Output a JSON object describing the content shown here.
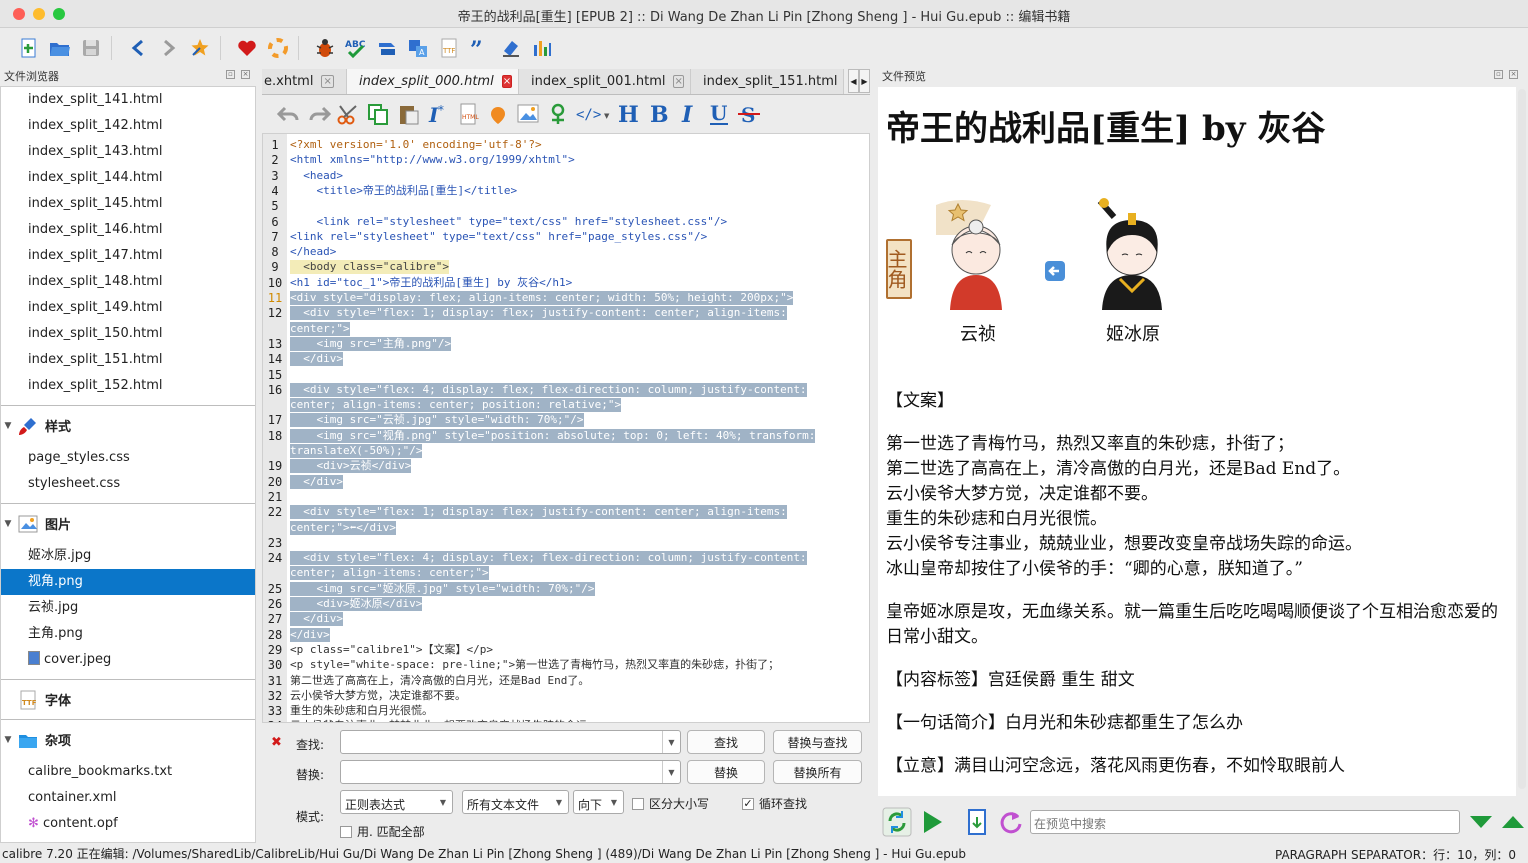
{
  "window": {
    "title": "帝王的战利品[重生] [EPUB 2] :: Di Wang De Zhan Li Pin [Zhong Sheng ] - Hui Gu.epub :: 编辑书籍"
  },
  "file_browser": {
    "title": "文件浏览器",
    "text_files": [
      "index_split_141.html",
      "index_split_142.html",
      "index_split_143.html",
      "index_split_144.html",
      "index_split_145.html",
      "index_split_146.html",
      "index_split_147.html",
      "index_split_148.html",
      "index_split_149.html",
      "index_split_150.html",
      "index_split_151.html",
      "index_split_152.html"
    ],
    "styles_label": "样式",
    "styles": [
      "page_styles.css",
      "stylesheet.css"
    ],
    "images_label": "图片",
    "images": [
      "姬冰原.jpg",
      "视角.png",
      "云祯.jpg",
      "主角.png",
      "cover.jpeg"
    ],
    "fonts_label": "字体",
    "misc_label": "杂项",
    "misc": [
      "calibre_bookmarks.txt",
      "container.xml",
      "content.opf"
    ]
  },
  "tabs": [
    {
      "label": "e.xhtml"
    },
    {
      "label": "index_split_000.html"
    },
    {
      "label": "index_split_001.html"
    },
    {
      "label": "index_split_151.html"
    }
  ],
  "editor": {
    "lines": [
      {
        "n": "1",
        "t": "<?xml version='1.0' encoding='utf-8'?>"
      },
      {
        "n": "2",
        "t": "<html xmlns=\"http://www.w3.org/1999/xhtml\">"
      },
      {
        "n": "3",
        "t": "  <head>"
      },
      {
        "n": "4",
        "t": "    <title>帝王的战利品[重生]</title>"
      },
      {
        "n": "5",
        "t": ""
      },
      {
        "n": "6",
        "t": "    <link rel=\"stylesheet\" type=\"text/css\" href=\"stylesheet.css\"/>"
      },
      {
        "n": "7",
        "t": "<link rel=\"stylesheet\" type=\"text/css\" href=\"page_styles.css\"/>"
      },
      {
        "n": "8",
        "t": "</head>"
      },
      {
        "n": "9",
        "t": "  <body class=\"calibre\">"
      },
      {
        "n": "10",
        "t": "<h1 id=\"toc_1\">帝王的战利品[重生] by 灰谷</h1>"
      },
      {
        "n": "11",
        "t": "<div style=\"display: flex; align-items: center; width: 50%; height: 200px;\">"
      },
      {
        "n": "12",
        "t": "  <div style=\"flex: 1; display: flex; justify-content: center; align-items:"
      },
      {
        "n": "",
        "t": "center;\">"
      },
      {
        "n": "13",
        "t": "    <img src=\"主角.png\"/>"
      },
      {
        "n": "14",
        "t": "  </div>"
      },
      {
        "n": "15",
        "t": ""
      },
      {
        "n": "16",
        "t": "  <div style=\"flex: 4; display: flex; flex-direction: column; justify-content:"
      },
      {
        "n": "",
        "t": "center; align-items: center; position: relative;\">"
      },
      {
        "n": "17",
        "t": "    <img src=\"云祯.jpg\" style=\"width: 70%;\"/>"
      },
      {
        "n": "18",
        "t": "    <img src=\"视角.png\" style=\"position: absolute; top: 0; left: 40%; transform:"
      },
      {
        "n": "",
        "t": "translateX(-50%);\"/>"
      },
      {
        "n": "19",
        "t": "    <div>云祯</div>"
      },
      {
        "n": "20",
        "t": "  </div>"
      },
      {
        "n": "21",
        "t": ""
      },
      {
        "n": "22",
        "t": "  <div style=\"flex: 1; display: flex; justify-content: center; align-items:"
      },
      {
        "n": "",
        "t": "center;\">⬅</div>"
      },
      {
        "n": "23",
        "t": ""
      },
      {
        "n": "24",
        "t": "  <div style=\"flex: 4; display: flex; flex-direction: column; justify-content:"
      },
      {
        "n": "",
        "t": "center; align-items: center;\">"
      },
      {
        "n": "25",
        "t": "    <img src=\"姬冰原.jpg\" style=\"width: 70%;\"/>"
      },
      {
        "n": "26",
        "t": "    <div>姬冰原</div>"
      },
      {
        "n": "27",
        "t": "  </div>"
      },
      {
        "n": "28",
        "t": "</div>"
      },
      {
        "n": "29",
        "t": "<p class=\"calibre1\">【文案】</p>"
      },
      {
        "n": "30",
        "t": "<p style=\"white-space: pre-line;\">第一世选了青梅竹马，热烈又率直的朱砂痣，扑街了；"
      },
      {
        "n": "31",
        "t": "第二世选了高高在上，清冷高傲的白月光，还是Bad End了。"
      },
      {
        "n": "32",
        "t": "云小侯爷大梦方觉，决定谁都不要。"
      },
      {
        "n": "33",
        "t": "重生的朱砂痣和白月光很慌。"
      },
      {
        "n": "34",
        "t": "云小侯爷专注事业，兢兢业业，想要改变皇帝战场失踪的命运。"
      }
    ]
  },
  "find": {
    "find_label": "查找:",
    "replace_label": "替换:",
    "mode_label": "模式:",
    "find_btn": "查找",
    "replace_find_btn": "替换与查找",
    "replace_btn": "替换",
    "replace_all_btn": "替换所有",
    "mode_value": "正则表达式",
    "scope_value": "所有文本文件",
    "direction_value": "向下",
    "case_label": "区分大小写",
    "wrap_label": "循环查找",
    "whole_label": "用. 匹配全部"
  },
  "preview": {
    "title": "文件预览",
    "h1": "帝王的战利品[重生] by 灰谷",
    "badge": "主角",
    "char1": "云祯",
    "char2": "姬冰原",
    "wenan": "【文案】",
    "para1": [
      "第一世选了青梅竹马，热烈又率直的朱砂痣，扑街了；",
      "第二世选了高高在上，清冷高傲的白月光，还是Bad End了。",
      "云小侯爷大梦方觉，决定谁都不要。",
      "重生的朱砂痣和白月光很慌。",
      "云小侯爷专注事业，兢兢业业，想要改变皇帝战场失踪的命运。",
      "冰山皇帝却按住了小侯爷的手：“卿的心意，朕知道了。”"
    ],
    "para2": "皇帝姬冰原是攻，无血缘关系。就一篇重生后吃吃喝喝顺便谈了个互相治愈恋爱的日常小甜文。",
    "tags": "【内容标签】宫廷侯爵 重生 甜文",
    "summary": "【一句话简介】白月光和朱砂痣都重生了怎么办",
    "theme": "【立意】满目山河空念远，落花风雨更伤春，不如怜取眼前人",
    "search_placeholder": "在预览中搜索"
  },
  "status": {
    "left": "calibre 7.20 正在编辑: /Volumes/SharedLib/CalibreLib/Hui Gu/Di Wang De Zhan Li Pin [Zhong Sheng ] (489)/Di Wang De Zhan Li Pin [Zhong Sheng ] - Hui Gu.epub",
    "right": "PARAGRAPH SEPARATOR：行：10，列：0"
  }
}
